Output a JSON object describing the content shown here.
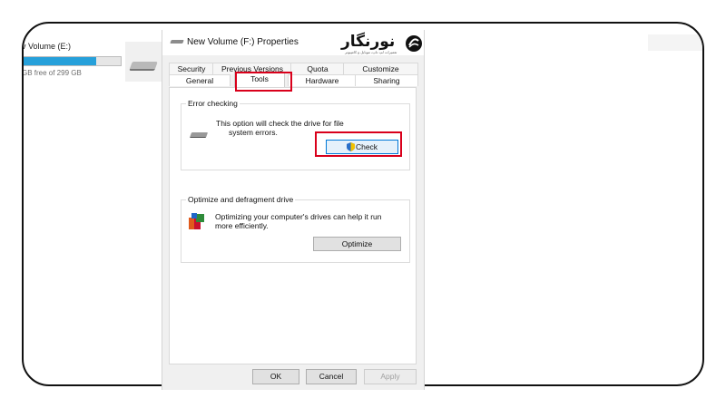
{
  "background": {
    "drive_label": "v Volume (E:)",
    "free_text": "GB free of 299 GB",
    "bar_fill_fraction": 0.75
  },
  "dialog": {
    "title": "New Volume (F:) Properties",
    "logo_text": "نورنگار",
    "logo_sub": "تعمیرات لپ تاپ، موبایل و کامپیوتر",
    "tabs_row1": [
      "Security",
      "Previous Versions",
      "Quota",
      "Customize"
    ],
    "tabs_row2": [
      "General",
      "Tools",
      "Hardware",
      "Sharing"
    ],
    "active_tab": "Tools",
    "error_checking": {
      "title": "Error checking",
      "desc_line1": "This option will check the drive for file",
      "desc_line2": "system errors.",
      "button": "Check"
    },
    "optimize": {
      "title": "Optimize and defragment drive",
      "desc_line1": "Optimizing your computer's drives can help it run",
      "desc_line2": "more efficiently.",
      "button": "Optimize"
    },
    "footer": {
      "ok": "OK",
      "cancel": "Cancel",
      "apply": "Apply"
    }
  },
  "colors": {
    "highlight": "#d9001b",
    "progress": "#26a0da"
  }
}
